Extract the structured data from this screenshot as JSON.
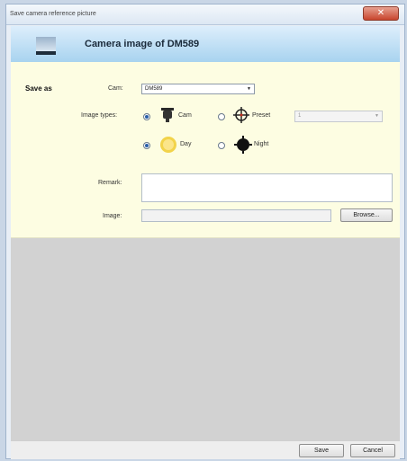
{
  "window": {
    "title": "Save camera reference picture"
  },
  "header": {
    "title": "Camera image of DM589",
    "icon": "landscape-picture-icon"
  },
  "form": {
    "save_as_label": "Save as",
    "cam_label": "Cam:",
    "cam_value": "DM589",
    "image_types_label": "Image types:",
    "type_cam_label": "Cam",
    "type_preset_label": "Preset",
    "preset_value": "1",
    "day_label": "Day",
    "night_label": "Night",
    "remark_label": "Remark:",
    "remark_value": "",
    "image_label": "Image:",
    "image_value": "",
    "browse_label": "Browse..."
  },
  "footer": {
    "save_label": "Save",
    "cancel_label": "Cancel"
  },
  "colors": {
    "header_gradient_top": "#ddeefc",
    "header_gradient_bottom": "#a8d3ef",
    "form_bg": "#fdfde2",
    "close_button": "#c8452d"
  }
}
